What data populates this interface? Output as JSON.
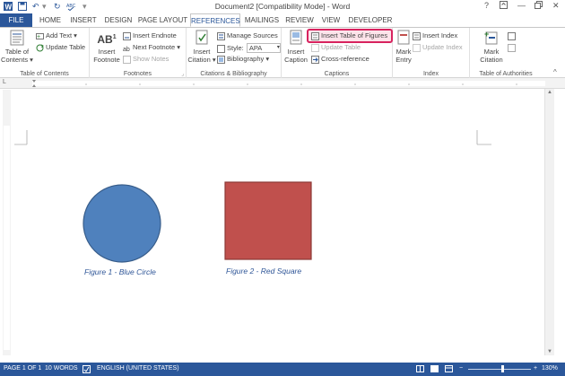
{
  "window": {
    "title": "Document2 [Compatibility Mode] - Word"
  },
  "tabs": [
    "FILE",
    "HOME",
    "INSERT",
    "DESIGN",
    "PAGE LAYOUT",
    "REFERENCES",
    "MAILINGS",
    "REVIEW",
    "VIEW",
    "DEVELOPER"
  ],
  "active_tab": "REFERENCES",
  "ribbon": {
    "toc": {
      "big_button": "Table of Contents",
      "add_text": "Add Text",
      "update_table": "Update Table",
      "group_label": "Table of Contents"
    },
    "footnotes": {
      "insert_footnote": "Insert Footnote",
      "insert_endnote": "Insert Endnote",
      "next_footnote": "Next Footnote",
      "show_notes": "Show Notes",
      "group_label": "Footnotes",
      "ab_glyph": "AB",
      "ab_sup": "1"
    },
    "citations": {
      "insert_citation": "Insert Citation",
      "manage_sources": "Manage Sources",
      "style_label": "Style:",
      "style_value": "APA",
      "bibliography": "Bibliography",
      "group_label": "Citations & Bibliography"
    },
    "captions": {
      "insert_caption": "Insert Caption",
      "insert_table_of_figures": "Insert Table of Figures",
      "update_table": "Update Table",
      "cross_reference": "Cross-reference",
      "group_label": "Captions"
    },
    "index": {
      "mark_entry": "Mark Entry",
      "insert_index": "Insert Index",
      "update_index": "Update Index",
      "group_label": "Index"
    },
    "authorities": {
      "mark_citation": "Mark Citation",
      "group_label": "Table of Authorities"
    }
  },
  "document": {
    "captions": [
      "Figure 1 - Blue Circle",
      "Figure 2 - Red Square"
    ],
    "shape_colors": {
      "circle_fill": "#4f81bd",
      "circle_stroke": "#385d8a",
      "square_fill": "#c0504d",
      "square_stroke": "#8c3836"
    }
  },
  "status_bar": {
    "page": "PAGE 1 OF 1",
    "words": "10 WORDS",
    "language": "ENGLISH (UNITED STATES)",
    "zoom": "130%"
  },
  "colors": {
    "accent": "#2b579a",
    "highlight": "#d8235f"
  }
}
